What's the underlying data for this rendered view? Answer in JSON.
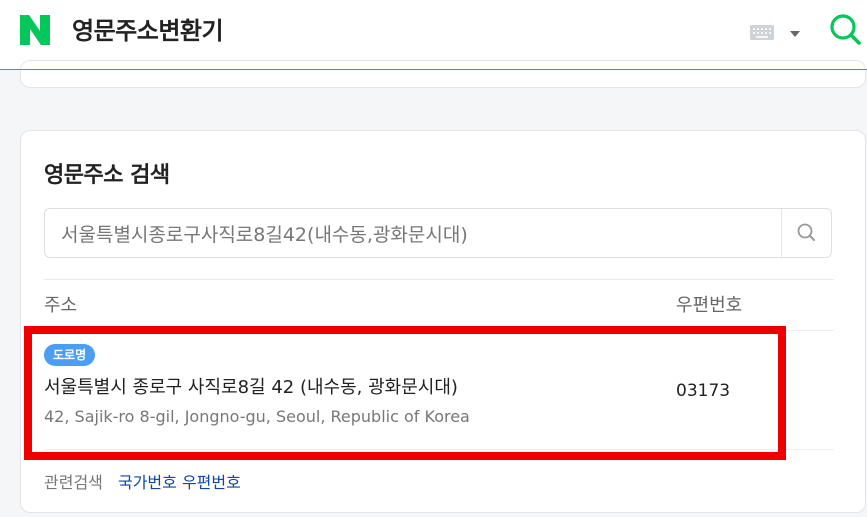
{
  "header": {
    "title": "영문주소변환기",
    "logo_letter": "N",
    "brand_color": "#03c75a"
  },
  "search_section": {
    "title": "영문주소 검색",
    "input_value": "서울특별시종로구사직로8길42(내수동,광화문시대)"
  },
  "table": {
    "headers": {
      "address": "주소",
      "zip": "우편번호"
    },
    "rows": [
      {
        "badge": "도로명",
        "address_ko": "서울특별시 종로구 사직로8길 42 (내수동, 광화문시대)",
        "address_en": "42, Sajik-ro 8-gil, Jongno-gu, Seoul, Republic of Korea",
        "zip": "03173"
      }
    ]
  },
  "related": {
    "label": "관련검색",
    "link": "국가번호 우편번호"
  },
  "icons": [
    "logo-icon",
    "keyboard-icon",
    "chevron-down-icon",
    "search-icon"
  ],
  "colors": {
    "badge": "#4a9ff5",
    "highlight": "#ee0000",
    "link": "#0b49a5"
  }
}
